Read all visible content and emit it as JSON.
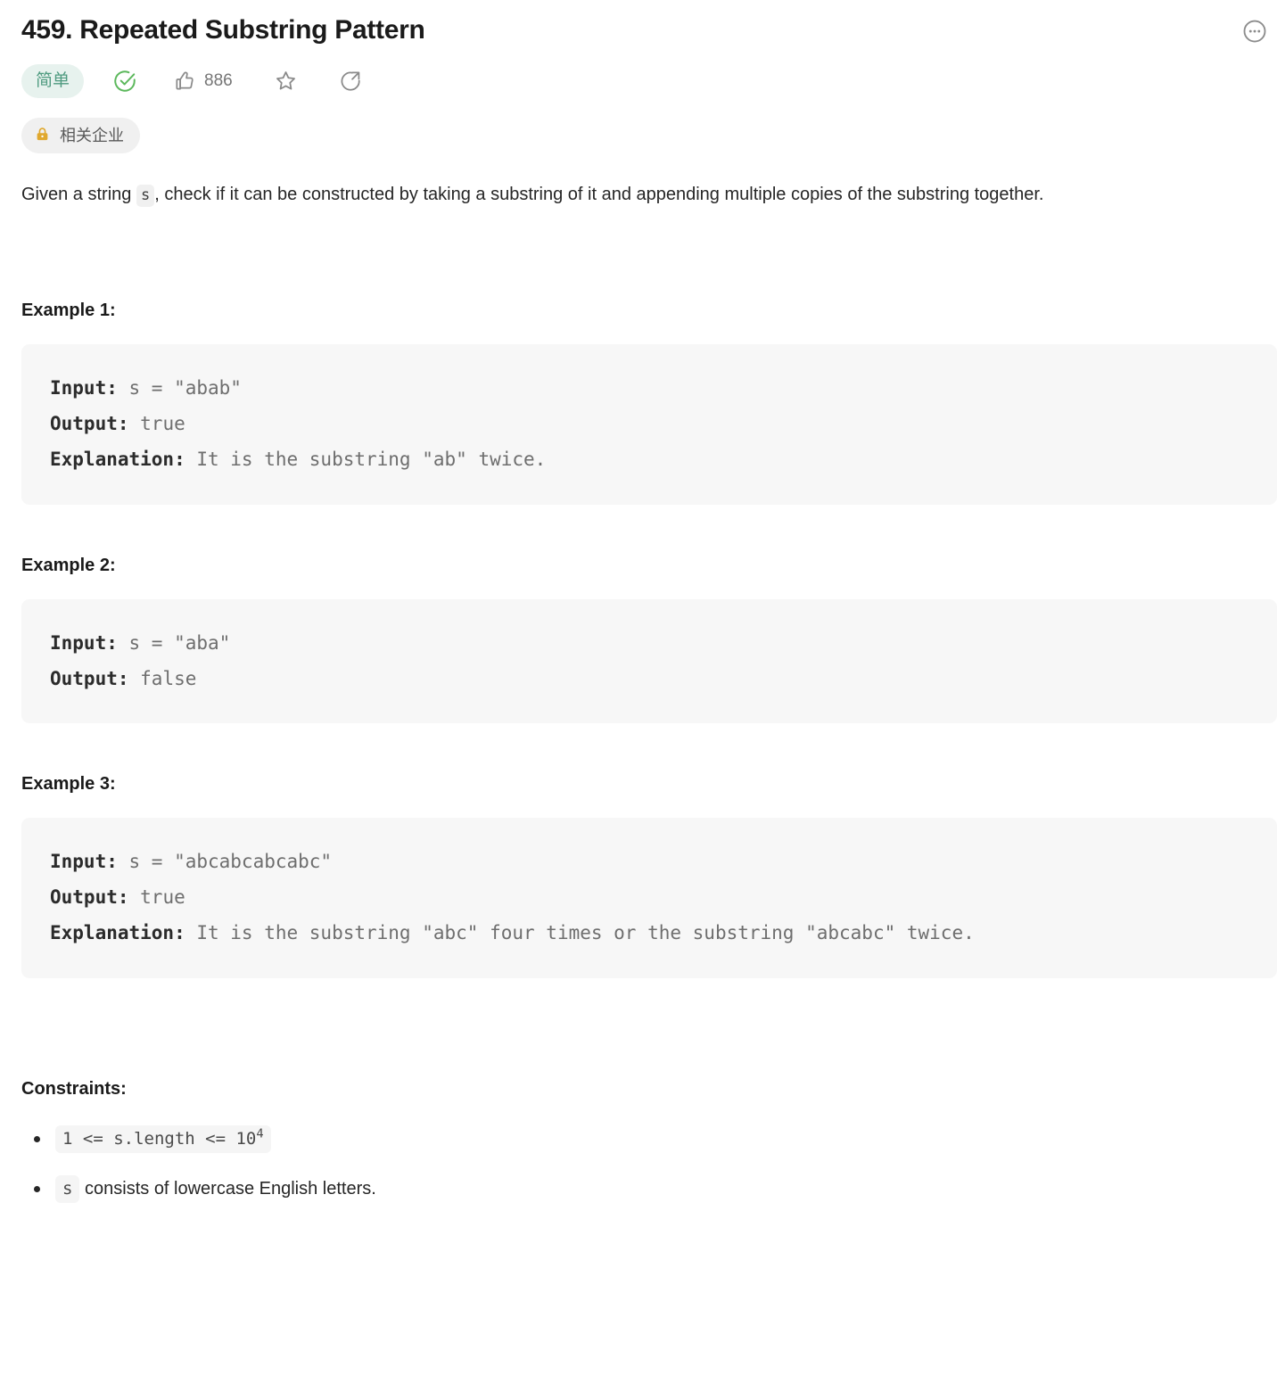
{
  "header": {
    "title": "459. Repeated Substring Pattern",
    "more_icon": "more-ellipsis-circle-icon"
  },
  "meta": {
    "difficulty_label": "简单",
    "difficulty_color": "#4f9b80",
    "difficulty_bg": "#e7f2ee",
    "solved_icon": "circle-check-icon",
    "solved_color": "#5cb85c",
    "like_icon": "thumbs-up-icon",
    "like_count": "886",
    "star_icon": "star-outline-icon",
    "share_icon": "share-arrow-icon"
  },
  "company_tag": {
    "lock_icon": "lock-icon",
    "lock_color": "#e0a82e",
    "label": "相关企业"
  },
  "description": {
    "part1": "Given a string ",
    "inline_code": "s",
    "part2": ", check if it can be constructed by taking a substring of it and appending multiple copies of the substring together."
  },
  "examples": [
    {
      "heading": "Example 1:",
      "lines": [
        {
          "label": "Input:",
          "value": " s = \"abab\""
        },
        {
          "label": "Output:",
          "value": " true"
        },
        {
          "label": "Explanation:",
          "value": " It is the substring \"ab\" twice."
        }
      ]
    },
    {
      "heading": "Example 2:",
      "lines": [
        {
          "label": "Input:",
          "value": " s = \"aba\""
        },
        {
          "label": "Output:",
          "value": " false"
        }
      ]
    },
    {
      "heading": "Example 3:",
      "lines": [
        {
          "label": "Input:",
          "value": " s = \"abcabcabcabc\""
        },
        {
          "label": "Output:",
          "value": " true"
        },
        {
          "label": "Explanation:",
          "value": " It is the substring \"abc\" four times or the substring \"abcabc\" twice."
        }
      ]
    }
  ],
  "constraints": {
    "heading": "Constraints:",
    "items": [
      {
        "code_base": "1 <= s.length <= 10",
        "code_sup": "4",
        "text": ""
      },
      {
        "code_base": "s",
        "code_sup": "",
        "text": " consists of lowercase English letters."
      }
    ]
  }
}
